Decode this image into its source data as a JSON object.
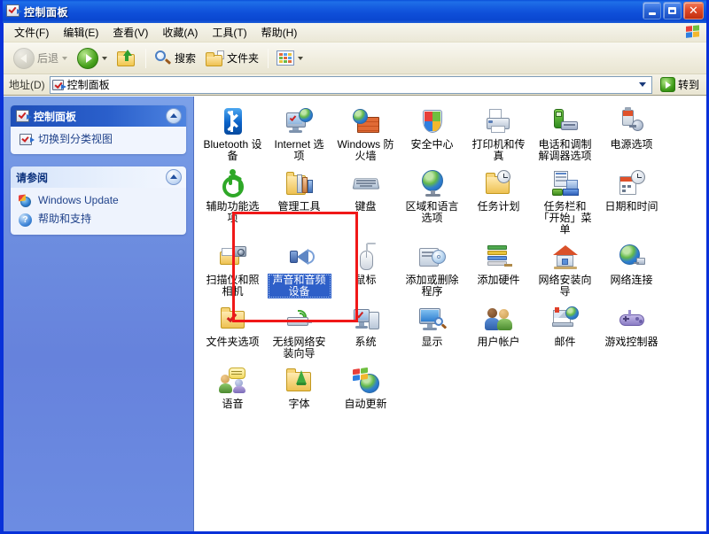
{
  "window": {
    "title": "控制面板",
    "title_icon": "control-panel-icon",
    "buttons": {
      "minimize": "_",
      "maximize": "▫",
      "close": "✕"
    }
  },
  "menu": {
    "items": [
      {
        "label": "文件(F)"
      },
      {
        "label": "编辑(E)"
      },
      {
        "label": "查看(V)"
      },
      {
        "label": "收藏(A)"
      },
      {
        "label": "工具(T)"
      },
      {
        "label": "帮助(H)"
      }
    ],
    "brand_icon": "windows-flag-icon"
  },
  "toolbar": {
    "back_label": "后退",
    "back_icon": "back-arrow-icon",
    "forward_icon": "forward-arrow-icon",
    "up_icon": "up-folder-icon",
    "search_label": "搜索",
    "search_icon": "search-icon",
    "folders_label": "文件夹",
    "folders_icon": "folders-icon",
    "views_icon": "views-grid-icon"
  },
  "address": {
    "label": "地址(D)",
    "value": "控制面板",
    "icon": "control-panel-icon",
    "dropdown_icon": "chevron-down-icon",
    "go_label": "转到",
    "go_icon": "go-arrow-icon"
  },
  "sidebar": {
    "panels": [
      {
        "title": "控制面板",
        "icon": "control-panel-icon",
        "style": "blue",
        "collapse_icon": "chevron-up-icon",
        "links": [
          {
            "label": "切换到分类视图",
            "icon": "switch-view-icon"
          }
        ]
      },
      {
        "title": "请参阅",
        "style": "pale",
        "collapse_icon": "chevron-up-icon",
        "links": [
          {
            "label": "Windows Update",
            "icon": "windows-update-icon"
          },
          {
            "label": "帮助和支持",
            "icon": "help-support-icon"
          }
        ]
      }
    ]
  },
  "content": {
    "selected_item": "声音和音频设备",
    "items": [
      {
        "label": "Bluetooth 设备",
        "icon": "bluetooth-icon"
      },
      {
        "label": "Internet 选项",
        "icon": "internet-options-icon"
      },
      {
        "label": "Windows 防火墙",
        "icon": "windows-firewall-icon"
      },
      {
        "label": "安全中心",
        "icon": "security-center-icon"
      },
      {
        "label": "打印机和传真",
        "icon": "printers-faxes-icon"
      },
      {
        "label": "电话和调制解调器选项",
        "icon": "phone-modem-icon"
      },
      {
        "label": "电源选项",
        "icon": "power-options-icon"
      },
      {
        "label": "辅助功能选项",
        "icon": "accessibility-icon"
      },
      {
        "label": "管理工具",
        "icon": "administrative-tools-icon"
      },
      {
        "label": "键盘",
        "icon": "keyboard-icon"
      },
      {
        "label": "区域和语言选项",
        "icon": "regional-language-icon"
      },
      {
        "label": "任务计划",
        "icon": "scheduled-tasks-icon"
      },
      {
        "label": "任务栏和「开始」菜单",
        "icon": "taskbar-startmenu-icon"
      },
      {
        "label": "日期和时间",
        "icon": "date-time-icon"
      },
      {
        "label": "扫描仪和照相机",
        "icon": "scanners-cameras-icon"
      },
      {
        "label": "声音和音频设备",
        "icon": "sounds-audio-icon",
        "selected": true
      },
      {
        "label": "鼠标",
        "icon": "mouse-icon"
      },
      {
        "label": "添加或删除程序",
        "icon": "add-remove-programs-icon"
      },
      {
        "label": "添加硬件",
        "icon": "add-hardware-icon"
      },
      {
        "label": "网络安装向导",
        "icon": "network-setup-wizard-icon"
      },
      {
        "label": "网络连接",
        "icon": "network-connections-icon"
      },
      {
        "label": "文件夹选项",
        "icon": "folder-options-icon"
      },
      {
        "label": "无线网络安装向导",
        "icon": "wireless-network-wizard-icon"
      },
      {
        "label": "系统",
        "icon": "system-icon"
      },
      {
        "label": "显示",
        "icon": "display-icon"
      },
      {
        "label": "用户帐户",
        "icon": "user-accounts-icon"
      },
      {
        "label": "邮件",
        "icon": "mail-icon"
      },
      {
        "label": "游戏控制器",
        "icon": "game-controllers-icon"
      },
      {
        "label": "语音",
        "icon": "speech-icon"
      },
      {
        "label": "字体",
        "icon": "fonts-icon"
      },
      {
        "label": "自动更新",
        "icon": "automatic-updates-icon"
      }
    ]
  },
  "annotation": {
    "shape": "rectangle",
    "color": "#F01818"
  },
  "colors": {
    "titlebar_blue": "#0831D9",
    "selection_blue": "#2E5FC8",
    "sidebar_blue": "#6E8FE0",
    "client_bg": "#ECE9D8",
    "annotation_red": "#F01818"
  }
}
